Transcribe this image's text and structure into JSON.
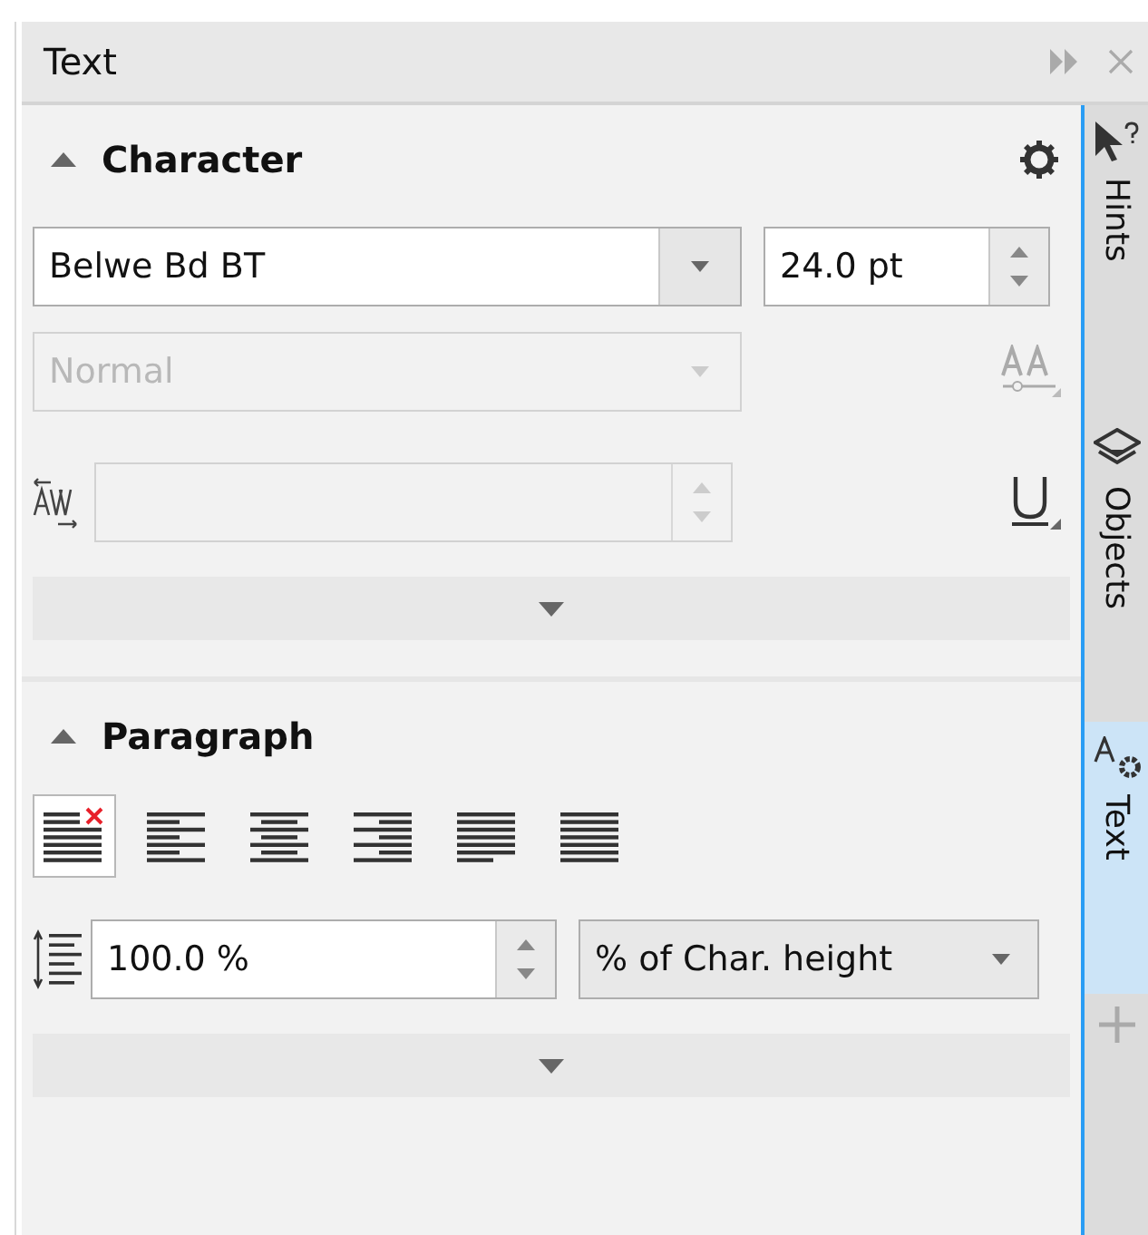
{
  "panel": {
    "title": "Text"
  },
  "character": {
    "title": "Character",
    "expanded": true,
    "font": {
      "value": "Belwe Bd BT"
    },
    "size": {
      "value": "24.0 pt"
    },
    "style": {
      "value": "Normal",
      "disabled": true
    },
    "kerning": {
      "disabled": true
    }
  },
  "paragraph": {
    "title": "Paragraph",
    "expanded": true,
    "alignments": [
      {
        "kind": "none",
        "selected": true
      },
      {
        "kind": "left",
        "selected": false
      },
      {
        "kind": "center",
        "selected": false
      },
      {
        "kind": "right",
        "selected": false
      },
      {
        "kind": "full",
        "selected": false
      },
      {
        "kind": "force",
        "selected": false
      }
    ],
    "spacing": {
      "value": "100.0 %"
    },
    "unit": {
      "value": "% of Char. height"
    }
  },
  "side_tabs": [
    {
      "label": "Hints",
      "kind": "hints",
      "selected": false
    },
    {
      "label": "Objects",
      "kind": "objects",
      "selected": false
    },
    {
      "label": "Text",
      "kind": "text",
      "selected": true
    }
  ]
}
